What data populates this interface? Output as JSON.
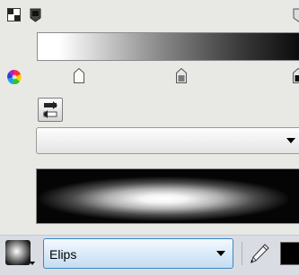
{
  "gradient_editor": {
    "colors": {
      "panel_background": "#e8e8e4",
      "gradient_start": "#ffffff",
      "gradient_end": "#050505",
      "toolbar_background": "#d9dce3",
      "select_border": "#3a87c5",
      "foreground_color": "#000000"
    },
    "icons": {
      "top_left": "gradient-type-icon",
      "top_left_2": "color-marker-icon",
      "top_right": "color-marker-icon",
      "color_wheel": "color-wheel-icon",
      "swap": "swap-arrows-icon",
      "pencil": "pencil-icon"
    },
    "blend_mode": {
      "value": ""
    },
    "toolbar": {
      "shape_value": "Elips"
    }
  }
}
